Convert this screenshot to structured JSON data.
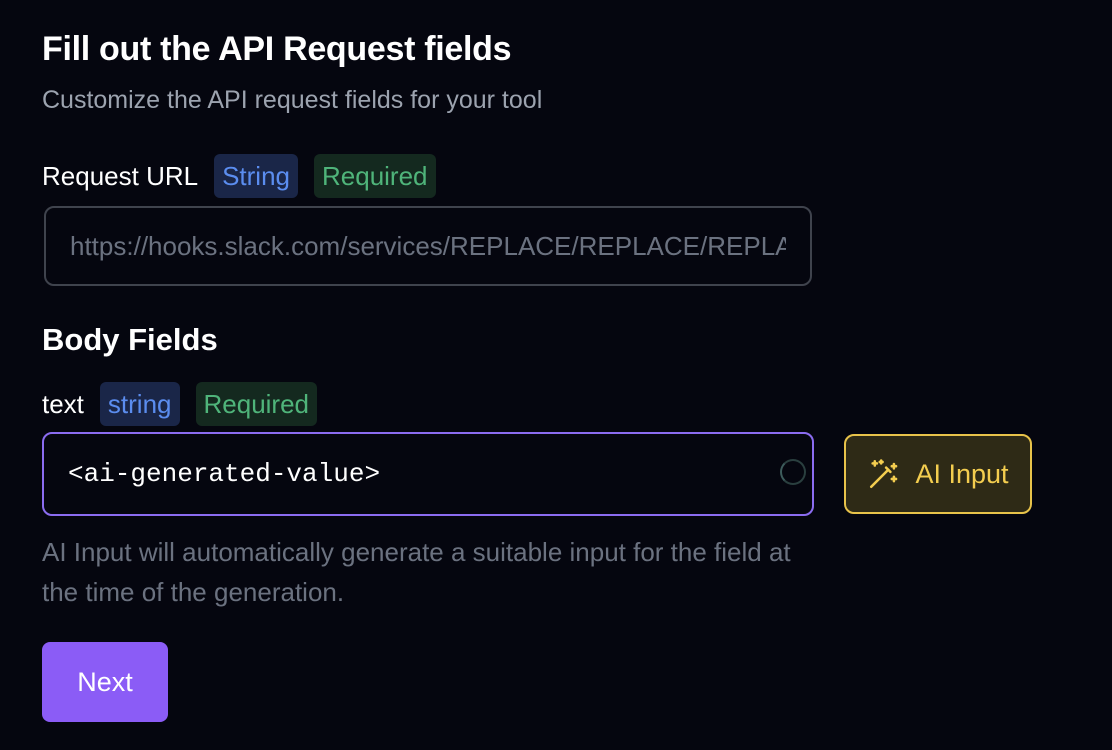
{
  "header": {
    "title": "Fill out the API Request fields",
    "subtitle": "Customize the API request fields for your tool"
  },
  "request_url": {
    "label": "Request URL",
    "type_badge": "String",
    "required_badge": "Required",
    "placeholder": "https://hooks.slack.com/services/REPLACE/REPLACE/REPLACE"
  },
  "body_fields": {
    "title": "Body Fields",
    "fields": [
      {
        "label": "text",
        "type_badge": "string",
        "required_badge": "Required",
        "value": "<ai-generated-value>"
      }
    ],
    "ai_button_label": "AI Input",
    "ai_button_icon": "magic-wand-icon",
    "helper_text": "AI Input will automatically generate a suitable input for the field at the time of the generation."
  },
  "actions": {
    "next_label": "Next"
  },
  "colors": {
    "background": "#05060f",
    "accent": "#8b5cf6",
    "ai_yellow": "#f3cd4f",
    "type_badge_text": "#5b8def",
    "required_badge_text": "#4fb47a"
  }
}
